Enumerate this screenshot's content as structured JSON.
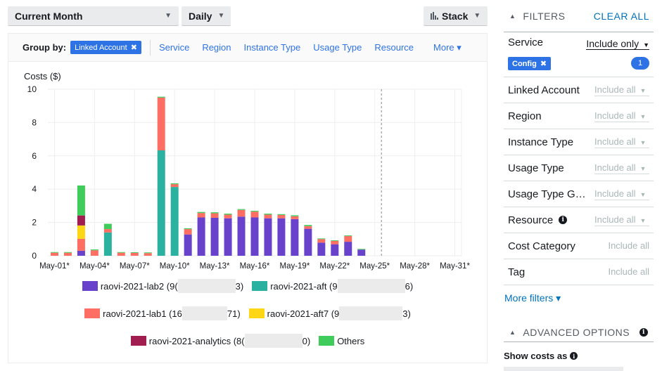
{
  "toolbar": {
    "date_range": "Current Month",
    "granularity": "Daily",
    "chart_style": "Stack",
    "caret": "▼"
  },
  "group_by": {
    "label": "Group by:",
    "selected": "Linked Account",
    "remove_icon": "✖",
    "options": [
      "Service",
      "Region",
      "Instance Type",
      "Usage Type",
      "Resource"
    ],
    "more": "More ▾"
  },
  "chart_data": {
    "type": "bar",
    "stacked": true,
    "title": "",
    "ylabel": "Costs ($)",
    "xlabel": "",
    "ylim": [
      0,
      10
    ],
    "yticks": [
      0,
      2,
      4,
      6,
      8,
      10
    ],
    "grid": true,
    "forecast_marker_after": "May-25*",
    "categories": [
      "May-01*",
      "May-02*",
      "May-03*",
      "May-04*",
      "May-05*",
      "May-06*",
      "May-07*",
      "May-08*",
      "May-09*",
      "May-10*",
      "May-11*",
      "May-12*",
      "May-13*",
      "May-14*",
      "May-15*",
      "May-16*",
      "May-17*",
      "May-18*",
      "May-19*",
      "May-20*",
      "May-21*",
      "May-22*",
      "May-23*",
      "May-24*",
      "May-25*",
      "May-26*",
      "May-27*",
      "May-28*",
      "May-29*",
      "May-30*",
      "May-31*"
    ],
    "xtick_labels": [
      "May-01*",
      "May-04*",
      "May-07*",
      "May-10*",
      "May-13*",
      "May-16*",
      "May-19*",
      "May-22*",
      "May-25*",
      "May-28*",
      "May-31*"
    ],
    "legend_position": "bottom",
    "series": [
      {
        "name": "raovi-2021-lab2",
        "color": "#6842cb",
        "values": [
          0,
          0,
          0.3,
          0,
          0,
          0,
          0,
          0,
          0,
          0,
          1.28,
          2.3,
          2.28,
          2.25,
          2.35,
          2.3,
          2.25,
          2.25,
          2.2,
          1.62,
          0.79,
          0.69,
          0.84,
          0.37,
          0,
          0,
          0,
          0,
          0,
          0,
          0
        ]
      },
      {
        "name": "raovi-2021-aft",
        "color": "#2bb19f",
        "values": [
          0,
          0,
          0,
          0,
          1.4,
          0,
          0,
          0,
          6.33,
          4.13,
          0,
          0,
          0,
          0,
          0,
          0,
          0,
          0,
          0,
          0,
          0,
          0,
          0,
          0,
          0,
          0,
          0,
          0,
          0,
          0,
          0
        ]
      },
      {
        "name": "raovi-2021-lab1",
        "color": "#fe6e63",
        "values": [
          0.18,
          0.18,
          0.72,
          0.33,
          0.2,
          0.18,
          0.17,
          0.16,
          3.17,
          0.17,
          0.32,
          0.27,
          0.27,
          0.22,
          0.4,
          0.35,
          0.22,
          0.2,
          0.17,
          0.16,
          0.21,
          0.2,
          0.34,
          0,
          0,
          0,
          0,
          0,
          0,
          0,
          0
        ]
      },
      {
        "name": "raovi-2021-aft7",
        "color": "#fdd616",
        "values": [
          0,
          0,
          0.8,
          0,
          0,
          0,
          0,
          0,
          0,
          0,
          0,
          0,
          0,
          0,
          0,
          0,
          0,
          0,
          0,
          0,
          0,
          0,
          0,
          0,
          0,
          0,
          0,
          0,
          0,
          0,
          0
        ]
      },
      {
        "name": "raovi-2021-analytics",
        "color": "#a11c4f",
        "values": [
          0,
          0,
          0.6,
          0,
          0,
          0,
          0,
          0,
          0,
          0,
          0,
          0,
          0,
          0,
          0,
          0,
          0,
          0,
          0,
          0,
          0,
          0,
          0,
          0,
          0,
          0,
          0,
          0,
          0,
          0,
          0
        ]
      },
      {
        "name": "Others",
        "color": "#3fcc5a",
        "values": [
          0.04,
          0.04,
          1.8,
          0.05,
          0.32,
          0.04,
          0.04,
          0.04,
          0.05,
          0.05,
          0.05,
          0.06,
          0.06,
          0.06,
          0.05,
          0.05,
          0.06,
          0.05,
          0.06,
          0.07,
          0.04,
          0.04,
          0.04,
          0.04,
          0,
          0,
          0,
          0,
          0,
          0,
          0
        ]
      }
    ]
  },
  "legend": [
    {
      "name": "raovi-2021-lab2",
      "prefix": "raovi-2021-lab2 (9(",
      "suffix": "3)",
      "color": "#6842cb"
    },
    {
      "name": "raovi-2021-aft",
      "prefix": "raovi-2021-aft (9",
      "suffix": "6)",
      "color": "#2bb19f"
    },
    {
      "name": "raovi-2021-lab1",
      "prefix": "raovi-2021-lab1 (16",
      "suffix": "71)",
      "color": "#fe6e63"
    },
    {
      "name": "raovi-2021-aft7",
      "prefix": "raovi-2021-aft7 (9",
      "suffix": "3)",
      "color": "#fdd616"
    },
    {
      "name": "raovi-2021-analytics",
      "prefix": "raovi-2021-analytics (8(",
      "suffix": "0)",
      "color": "#a11c4f"
    },
    {
      "name": "Others",
      "prefix": "Others",
      "suffix": "",
      "color": "#3fcc5a"
    }
  ],
  "filters": {
    "header": "FILTERS",
    "clear_all": "CLEAR ALL",
    "service": {
      "label": "Service",
      "mode": "Include only",
      "chip": "Config",
      "count": "1"
    },
    "rows": [
      {
        "label": "Linked Account",
        "value": "Include all",
        "dropdown": true
      },
      {
        "label": "Region",
        "value": "Include all",
        "dropdown": true
      },
      {
        "label": "Instance Type",
        "value": "Include all",
        "dropdown": true
      },
      {
        "label": "Usage Type",
        "value": "Include all",
        "dropdown": true
      },
      {
        "label": "Usage Type G…",
        "value": "Include all",
        "dropdown": true
      },
      {
        "label": "Resource",
        "value": "Include all",
        "dropdown": true,
        "info": true
      },
      {
        "label": "Cost Category",
        "value": "Include all",
        "dropdown": false
      },
      {
        "label": "Tag",
        "value": "Include all",
        "dropdown": false
      }
    ],
    "more_filters": "More filters ▾",
    "advanced_options": "ADVANCED OPTIONS",
    "show_costs_as": "Show costs as"
  }
}
